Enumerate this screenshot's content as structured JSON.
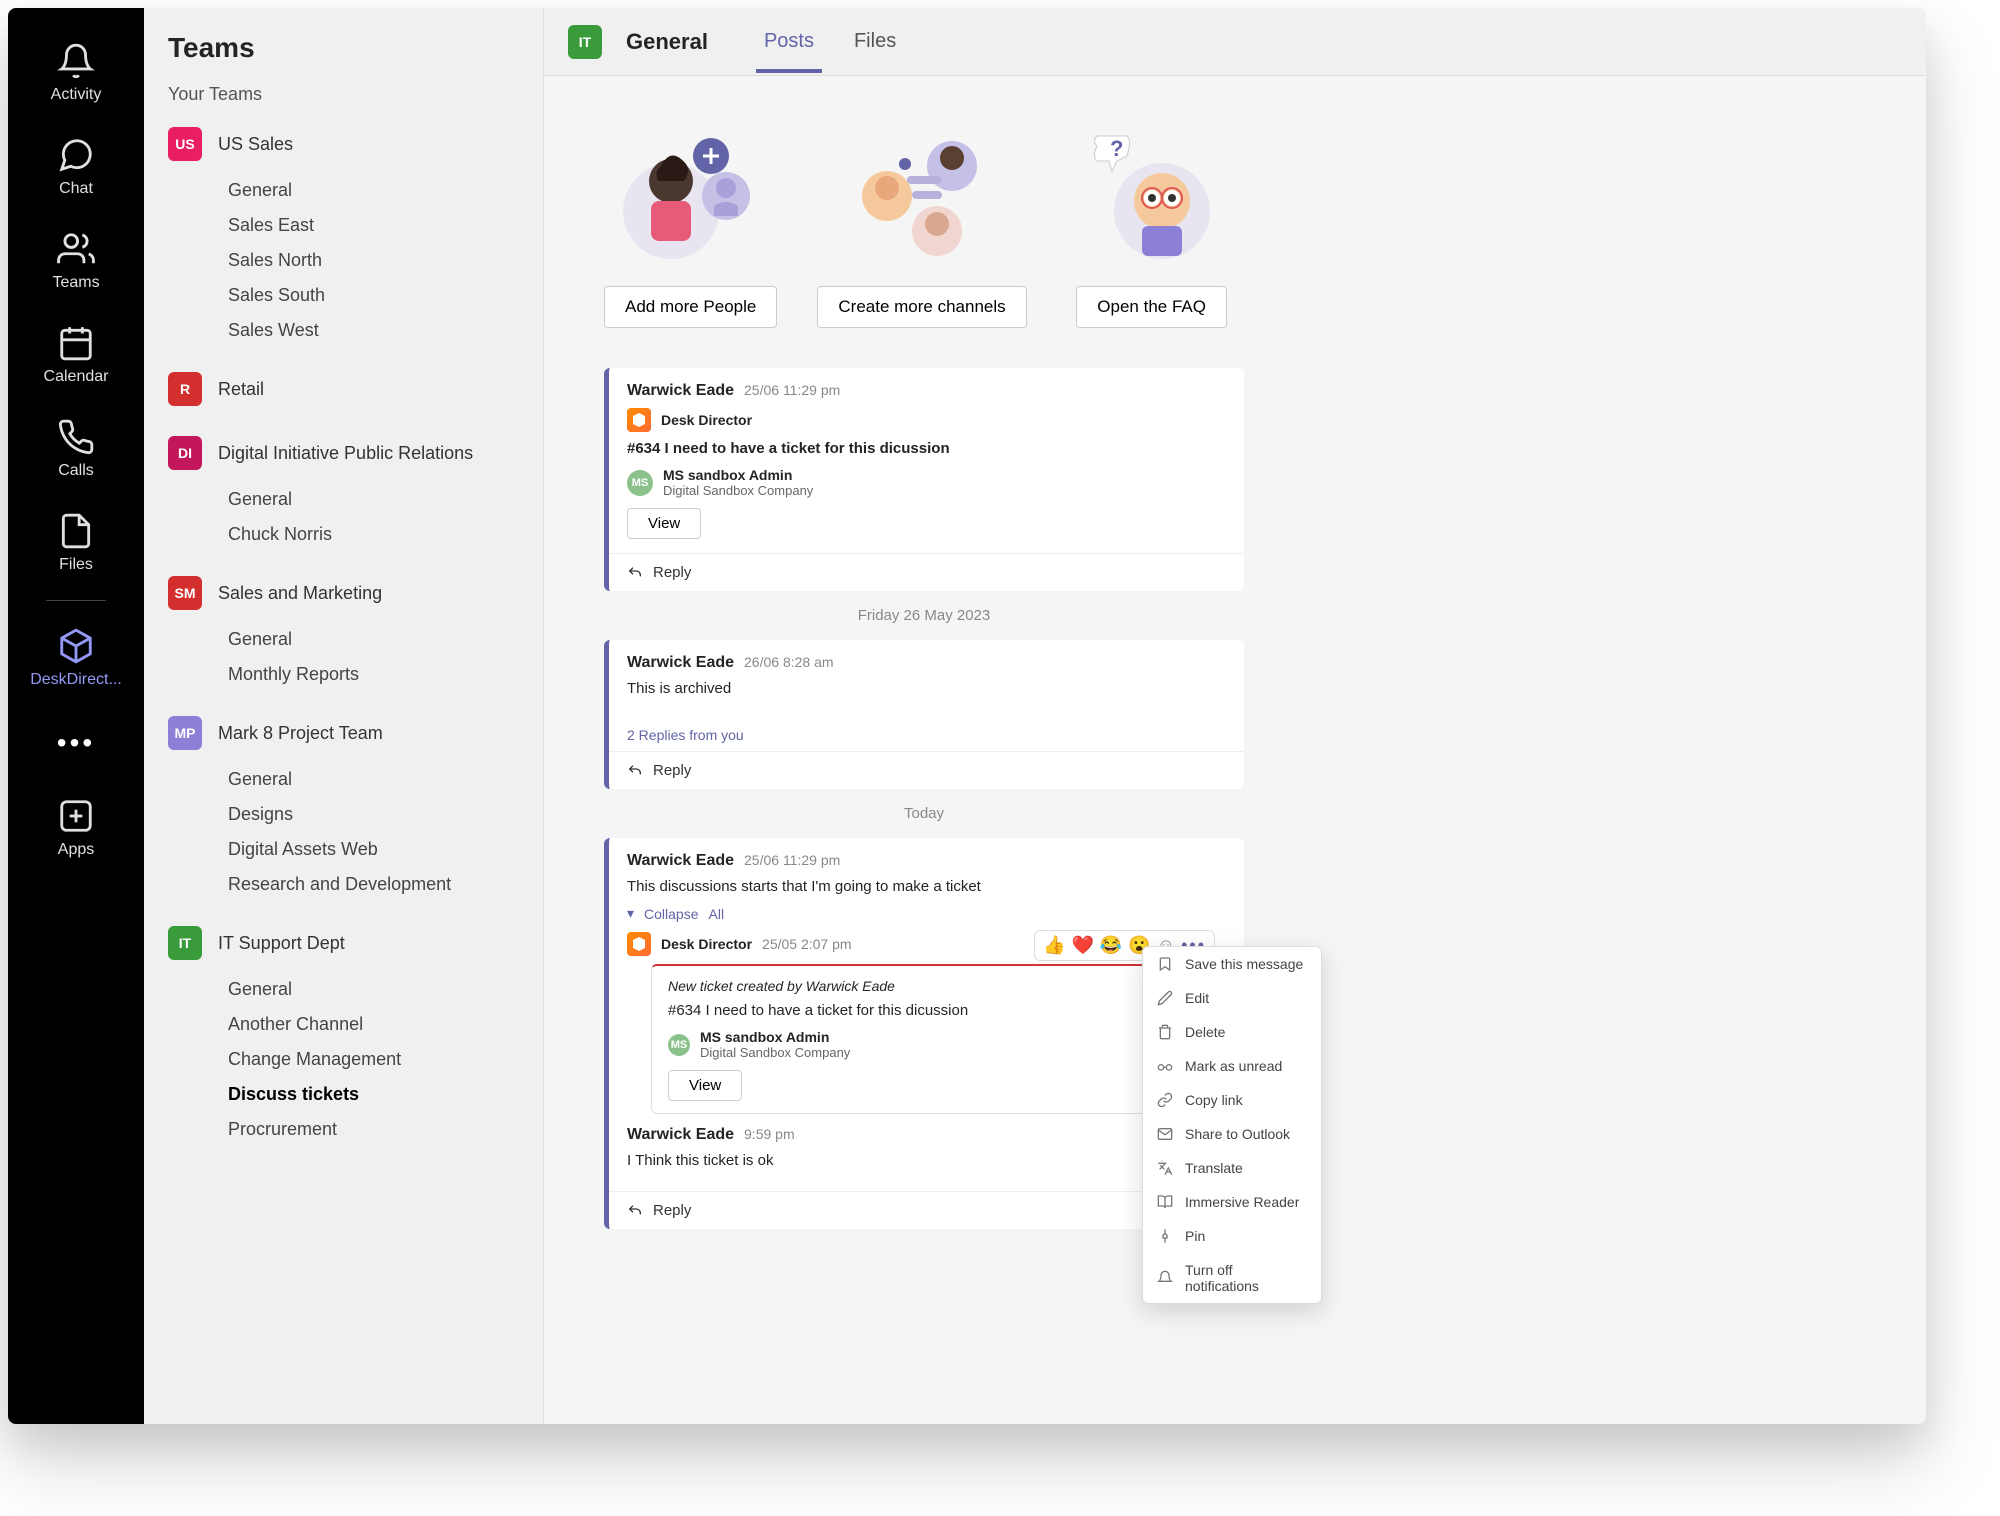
{
  "rail": {
    "items": [
      {
        "label": "Activity"
      },
      {
        "label": "Chat"
      },
      {
        "label": "Teams"
      },
      {
        "label": "Calendar"
      },
      {
        "label": "Calls"
      },
      {
        "label": "Files"
      },
      {
        "label": "DeskDirect..."
      },
      {
        "label": "Apps"
      }
    ]
  },
  "sidebar": {
    "title": "Teams",
    "subtitle": "Your Teams",
    "teams": [
      {
        "badge": "US",
        "color": "#e91e63",
        "name": "US Sales",
        "channels": [
          "General",
          "Sales East",
          "Sales North",
          "Sales South",
          "Sales West"
        ]
      },
      {
        "badge": "R",
        "color": "#d32f2f",
        "name": "Retail",
        "channels": []
      },
      {
        "badge": "DI",
        "color": "#c2185b",
        "name": "Digital Initiative Public Relations",
        "channels": [
          "General",
          "Chuck Norris"
        ]
      },
      {
        "badge": "SM",
        "color": "#d32f2f",
        "name": "Sales and Marketing",
        "channels": [
          "General",
          "Monthly Reports"
        ]
      },
      {
        "badge": "MP",
        "color": "#8b7fd6",
        "name": "Mark 8 Project Team",
        "channels": [
          "General",
          "Designs",
          "Digital Assets Web",
          "Research and Development"
        ]
      },
      {
        "badge": "IT",
        "color": "#3a9b3a",
        "name": "IT Support Dept",
        "channels": [
          "General",
          "Another Channel",
          "Change Management",
          "Discuss tickets",
          "Procrurement"
        ],
        "active_channel": "Discuss tickets"
      }
    ]
  },
  "header": {
    "badge": "IT",
    "title": "General",
    "tabs": [
      "Posts",
      "Files"
    ],
    "active_tab": "Posts"
  },
  "welcome": {
    "buttons": [
      "Add more People",
      "Create more channels",
      "Open the FAQ"
    ]
  },
  "posts": [
    {
      "author": "Warwick Eade",
      "time": "25/06 11:29 pm",
      "app": "Desk Director",
      "card_title": "#634 I need to have a ticket for this dicussion",
      "user_name": "MS sandbox Admin",
      "user_sub": "Digital Sandbox Company",
      "view_label": "View",
      "reply_label": "Reply"
    }
  ],
  "date1": "Friday 26 May 2023",
  "post2": {
    "author": "Warwick Eade",
    "time": "26/06 8:28 am",
    "text": "This is archived",
    "replies_link": "2 Replies from you",
    "reply_label": "Reply"
  },
  "date2": "Today",
  "post3": {
    "author": "Warwick Eade",
    "time": "25/06 11:29 pm",
    "text": "This discussions starts that I'm going to make a ticket",
    "collapse": "Collapse",
    "all": "All",
    "nested": {
      "app": "Desk Director",
      "time": "25/05 2:07 pm",
      "banner": "New ticket created by Warwick Eade",
      "title": "#634 I need to have a ticket for this dicussion",
      "user_name": "MS sandbox Admin",
      "user_sub": "Digital Sandbox Company",
      "view_label": "View"
    },
    "reply2": {
      "author": "Warwick Eade",
      "time": "9:59 pm",
      "text": "I Think this ticket is ok"
    },
    "reply_label": "Reply"
  },
  "reactions": [
    "👍",
    "❤️",
    "😂",
    "😮"
  ],
  "context_menu": [
    "Save this message",
    "Edit",
    "Delete",
    "Mark as unread",
    "Copy link",
    "Share to Outlook",
    "Translate",
    "Immersive Reader",
    "Pin",
    "Turn off notifications"
  ]
}
